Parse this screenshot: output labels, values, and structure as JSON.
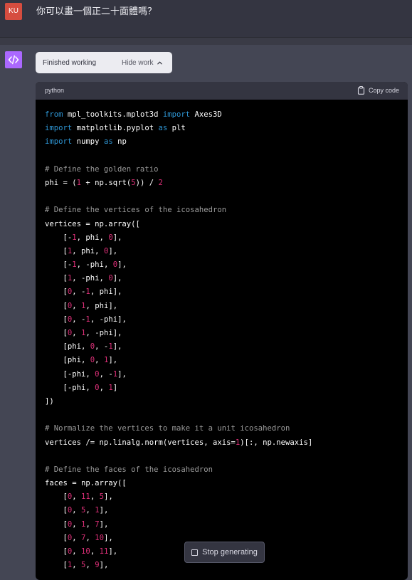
{
  "user": {
    "avatar_initials": "KU",
    "avatar_color": "#d64d3f",
    "message": "你可以畫一個正二十面體嗎？"
  },
  "assistant": {
    "avatar_icon": "code-icon",
    "avatar_color": "#ab68ff",
    "work_status": "Finished working",
    "work_toggle_label": "Hide work",
    "work_toggle_icon": "chevron-up-icon"
  },
  "code_block": {
    "language": "python",
    "copy_label": "Copy code",
    "copy_icon": "clipboard-icon",
    "colors": {
      "keyword": "#2e95d3",
      "number": "#df3079",
      "comment": "#9b9b9b",
      "text": "#ffffff"
    },
    "lines": [
      [
        [
          "from",
          "kw"
        ],
        [
          " mpl_toolkits.mplot3d ",
          ""
        ],
        [
          "import",
          "kw"
        ],
        [
          " Axes3D",
          ""
        ]
      ],
      [
        [
          "import",
          "kw"
        ],
        [
          " matplotlib.pyplot ",
          ""
        ],
        [
          "as",
          "kw"
        ],
        [
          " plt",
          ""
        ]
      ],
      [
        [
          "import",
          "kw"
        ],
        [
          " numpy ",
          ""
        ],
        [
          "as",
          "kw"
        ],
        [
          " np",
          ""
        ]
      ],
      [],
      [
        [
          "# Define the golden ratio",
          "comment"
        ]
      ],
      [
        [
          "phi = (",
          ""
        ],
        [
          "1",
          "num"
        ],
        [
          " + np.sqrt(",
          ""
        ],
        [
          "5",
          "num"
        ],
        [
          ")) / ",
          ""
        ],
        [
          "2",
          "num"
        ]
      ],
      [],
      [
        [
          "# Define the vertices of the icosahedron",
          "comment"
        ]
      ],
      [
        [
          "vertices = np.array([",
          ""
        ]
      ],
      [
        [
          "    [-",
          ""
        ],
        [
          "1",
          "num"
        ],
        [
          ", phi, ",
          ""
        ],
        [
          "0",
          "num"
        ],
        [
          "],",
          ""
        ]
      ],
      [
        [
          "    [",
          ""
        ],
        [
          "1",
          "num"
        ],
        [
          ", phi, ",
          ""
        ],
        [
          "0",
          "num"
        ],
        [
          "],",
          ""
        ]
      ],
      [
        [
          "    [-",
          ""
        ],
        [
          "1",
          "num"
        ],
        [
          ", -phi, ",
          ""
        ],
        [
          "0",
          "num"
        ],
        [
          "],",
          ""
        ]
      ],
      [
        [
          "    [",
          ""
        ],
        [
          "1",
          "num"
        ],
        [
          ", -phi, ",
          ""
        ],
        [
          "0",
          "num"
        ],
        [
          "],",
          ""
        ]
      ],
      [
        [
          "    [",
          ""
        ],
        [
          "0",
          "num"
        ],
        [
          ", -",
          ""
        ],
        [
          "1",
          "num"
        ],
        [
          ", phi],",
          ""
        ]
      ],
      [
        [
          "    [",
          ""
        ],
        [
          "0",
          "num"
        ],
        [
          ", ",
          ""
        ],
        [
          "1",
          "num"
        ],
        [
          ", phi],",
          ""
        ]
      ],
      [
        [
          "    [",
          ""
        ],
        [
          "0",
          "num"
        ],
        [
          ", -",
          ""
        ],
        [
          "1",
          "num"
        ],
        [
          ", -phi],",
          ""
        ]
      ],
      [
        [
          "    [",
          ""
        ],
        [
          "0",
          "num"
        ],
        [
          ", ",
          ""
        ],
        [
          "1",
          "num"
        ],
        [
          ", -phi],",
          ""
        ]
      ],
      [
        [
          "    [phi, ",
          ""
        ],
        [
          "0",
          "num"
        ],
        [
          ", -",
          ""
        ],
        [
          "1",
          "num"
        ],
        [
          "],",
          ""
        ]
      ],
      [
        [
          "    [phi, ",
          ""
        ],
        [
          "0",
          "num"
        ],
        [
          ", ",
          ""
        ],
        [
          "1",
          "num"
        ],
        [
          "],",
          ""
        ]
      ],
      [
        [
          "    [-phi, ",
          ""
        ],
        [
          "0",
          "num"
        ],
        [
          ", -",
          ""
        ],
        [
          "1",
          "num"
        ],
        [
          "],",
          ""
        ]
      ],
      [
        [
          "    [-phi, ",
          ""
        ],
        [
          "0",
          "num"
        ],
        [
          ", ",
          ""
        ],
        [
          "1",
          "num"
        ],
        [
          "]",
          ""
        ]
      ],
      [
        [
          "])",
          ""
        ]
      ],
      [],
      [
        [
          "# Normalize the vertices to make it a unit icosahedron",
          "comment"
        ]
      ],
      [
        [
          "vertices /= np.linalg.norm(vertices, axis=",
          ""
        ],
        [
          "1",
          "num"
        ],
        [
          ")[:, np.newaxis]",
          ""
        ]
      ],
      [],
      [
        [
          "# Define the faces of the icosahedron",
          "comment"
        ]
      ],
      [
        [
          "faces = np.array([",
          ""
        ]
      ],
      [
        [
          "    [",
          ""
        ],
        [
          "0",
          "num"
        ],
        [
          ", ",
          ""
        ],
        [
          "11",
          "num"
        ],
        [
          ", ",
          ""
        ],
        [
          "5",
          "num"
        ],
        [
          "],",
          ""
        ]
      ],
      [
        [
          "    [",
          ""
        ],
        [
          "0",
          "num"
        ],
        [
          ", ",
          ""
        ],
        [
          "5",
          "num"
        ],
        [
          ", ",
          ""
        ],
        [
          "1",
          "num"
        ],
        [
          "],",
          ""
        ]
      ],
      [
        [
          "    [",
          ""
        ],
        [
          "0",
          "num"
        ],
        [
          ", ",
          ""
        ],
        [
          "1",
          "num"
        ],
        [
          ", ",
          ""
        ],
        [
          "7",
          "num"
        ],
        [
          "],",
          ""
        ]
      ],
      [
        [
          "    [",
          ""
        ],
        [
          "0",
          "num"
        ],
        [
          ", ",
          ""
        ],
        [
          "7",
          "num"
        ],
        [
          ", ",
          ""
        ],
        [
          "10",
          "num"
        ],
        [
          "],",
          ""
        ]
      ],
      [
        [
          "    [",
          ""
        ],
        [
          "0",
          "num"
        ],
        [
          ", ",
          ""
        ],
        [
          "10",
          "num"
        ],
        [
          ", ",
          ""
        ],
        [
          "11",
          "num"
        ],
        [
          "],",
          ""
        ]
      ],
      [
        [
          "    [",
          ""
        ],
        [
          "1",
          "num"
        ],
        [
          ", ",
          ""
        ],
        [
          "5",
          "num"
        ],
        [
          ", ",
          ""
        ],
        [
          "9",
          "num"
        ],
        [
          "],",
          ""
        ]
      ]
    ]
  },
  "stop_button": {
    "label": "Stop generating",
    "icon": "stop-square-icon"
  }
}
